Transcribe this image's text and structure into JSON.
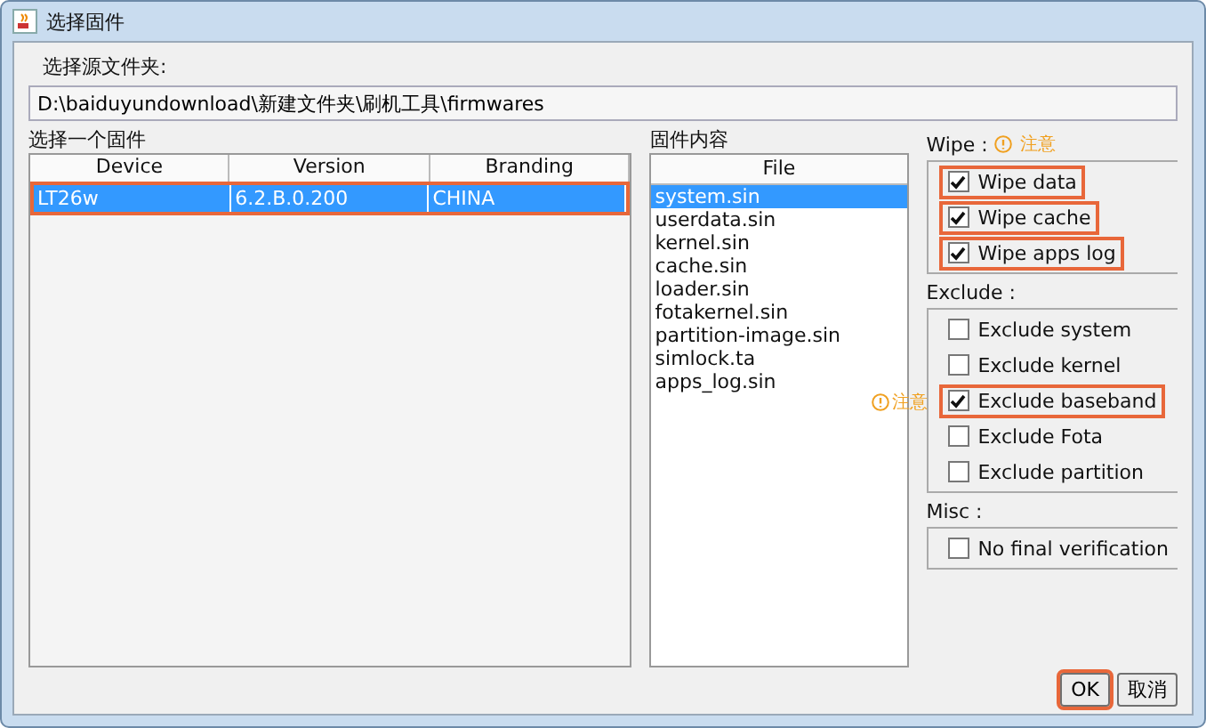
{
  "window": {
    "title": "选择固件"
  },
  "source": {
    "label": "选择源文件夹:",
    "value": "D:\\baiduyundownload\\新建文件夹\\刷机工具\\firmwares"
  },
  "firmware_table": {
    "label": "选择一个固件",
    "columns": [
      "Device",
      "Version",
      "Branding"
    ],
    "rows": [
      {
        "cells": [
          "LT26w",
          "6.2.B.0.200",
          "CHINA"
        ],
        "selected": true,
        "highlighted": true
      }
    ]
  },
  "content": {
    "label": "固件内容",
    "column": "File",
    "files": [
      {
        "name": "system.sin",
        "selected": true
      },
      {
        "name": "userdata.sin",
        "selected": false
      },
      {
        "name": "kernel.sin",
        "selected": false
      },
      {
        "name": "cache.sin",
        "selected": false
      },
      {
        "name": "loader.sin",
        "selected": false
      },
      {
        "name": "fotakernel.sin",
        "selected": false
      },
      {
        "name": "partition-image.sin",
        "selected": false
      },
      {
        "name": "simlock.ta",
        "selected": false
      },
      {
        "name": "apps_log.sin",
        "selected": false
      }
    ]
  },
  "groups": [
    {
      "label": "Wipe :",
      "note": "注意",
      "items": [
        {
          "label": "Wipe data",
          "checked": true,
          "highlighted": true
        },
        {
          "label": "Wipe cache",
          "checked": true,
          "highlighted": true
        },
        {
          "label": "Wipe apps log",
          "checked": true,
          "highlighted": true
        }
      ]
    },
    {
      "label": "Exclude :",
      "items": [
        {
          "label": "Exclude system",
          "checked": false,
          "highlighted": false
        },
        {
          "label": "Exclude kernel",
          "checked": false,
          "highlighted": false
        },
        {
          "label": "Exclude baseband",
          "checked": true,
          "highlighted": true,
          "note": "注意"
        },
        {
          "label": "Exclude Fota",
          "checked": false,
          "highlighted": false
        },
        {
          "label": "Exclude partition",
          "checked": false,
          "highlighted": false
        }
      ]
    },
    {
      "label": "Misc :",
      "items": [
        {
          "label": "No final verification",
          "checked": false,
          "highlighted": false
        }
      ]
    }
  ],
  "buttons": [
    {
      "label": "OK",
      "highlighted": true
    },
    {
      "label": "取消",
      "highlighted": false
    }
  ]
}
